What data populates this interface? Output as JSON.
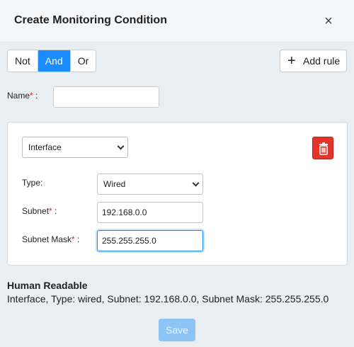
{
  "dialog": {
    "title": "Create Monitoring Condition",
    "close_symbol": "×"
  },
  "logic_operators": [
    "Not",
    "And",
    "Or"
  ],
  "logic_selected": "And",
  "add_rule": {
    "icon": "plus-icon",
    "label": "Add rule"
  },
  "name_field": {
    "label": "Name",
    "required_mark": "*",
    "colon": " :",
    "value": ""
  },
  "rule": {
    "condition_select": "Interface",
    "delete_icon": "trash-icon",
    "type": {
      "label": "Type:",
      "value": "Wired"
    },
    "subnet": {
      "label": "Subnet",
      "required_mark": "*",
      "colon": " :",
      "value": "192.168.0.0"
    },
    "subnet_mask": {
      "label": "Subnet Mask",
      "required_mark": "*",
      "colon": " :",
      "value": "255.255.255.0"
    }
  },
  "human_readable": {
    "title": "Human Readable",
    "text": "Interface, Type: wired, Subnet: 192.168.0.0, Subnet Mask: 255.255.255.0"
  },
  "save_button": {
    "label": "Save",
    "enabled": false
  },
  "colors": {
    "accent": "#1a8cff",
    "danger": "#e5352b",
    "required": "#e02424",
    "save_disabled": "#8cc4f5"
  }
}
